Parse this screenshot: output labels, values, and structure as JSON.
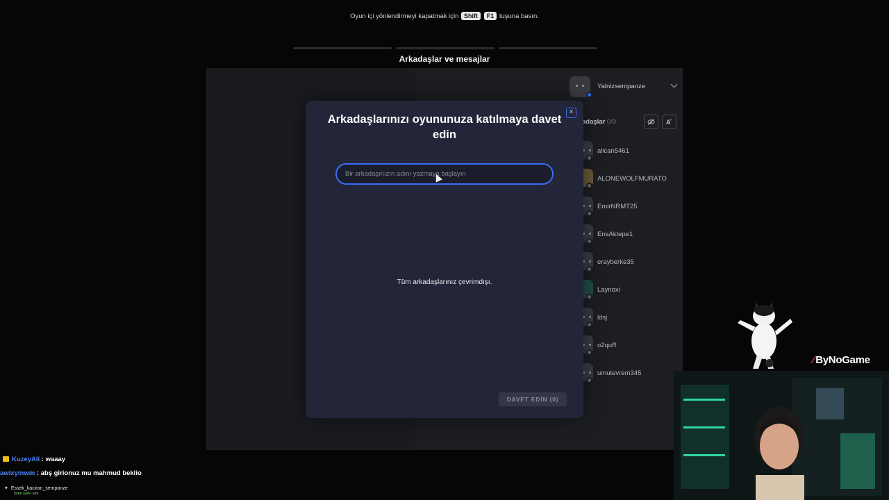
{
  "hint": {
    "before": "Oyun içi yönlendirmeyi kapatmak için",
    "key1": "Shift",
    "key2": "F1",
    "after": "tuşuna basın."
  },
  "overlay": {
    "title": "Arkadaşlar ve mesajlar"
  },
  "user": {
    "name": "Yalnizsempanze",
    "status_color": "#2f6cf0"
  },
  "friends_panel": {
    "title": "adaşlar",
    "count": "0/9",
    "hide_icon": "eye-off-icon",
    "add_icon": "add-friend-icon",
    "friends": [
      {
        "name": "alican5461"
      },
      {
        "name": "ALONEWOLFMURATO"
      },
      {
        "name": "EmirNRMT25"
      },
      {
        "name": "EnsAktepe1"
      },
      {
        "name": "erayberke35"
      },
      {
        "name": "Laynoxi"
      },
      {
        "name": "ldsj"
      },
      {
        "name": "o2quR"
      },
      {
        "name": "umutevrem345"
      }
    ]
  },
  "modal": {
    "title": "Arkadaşlarınızı oyununuza katılmaya davet edin",
    "close_label": "×",
    "search_placeholder": "Bir arkadaşınızın adını yazmaya başlayın",
    "search_value": "",
    "empty_message": "Tüm arkadaşlarınız çevrimdışı.",
    "invite_label": "DAVET EDİN (0)",
    "accent_color": "#3c6cf5"
  },
  "stream": {
    "brand": "ByNoGame",
    "brand_color": "#e23c3c",
    "chat": [
      {
        "user": "KuzeyAli",
        "text": ": waaay",
        "user_color": "#4a86ff"
      },
      {
        "user": "awixymwm",
        "text": ": abş girionuz mu mahmud beklio",
        "user_color": "#4a86ff"
      }
    ],
    "notification": {
      "text": "Essek_kaciran_sempanze",
      "sub": "İstek şarkı aldı"
    }
  }
}
